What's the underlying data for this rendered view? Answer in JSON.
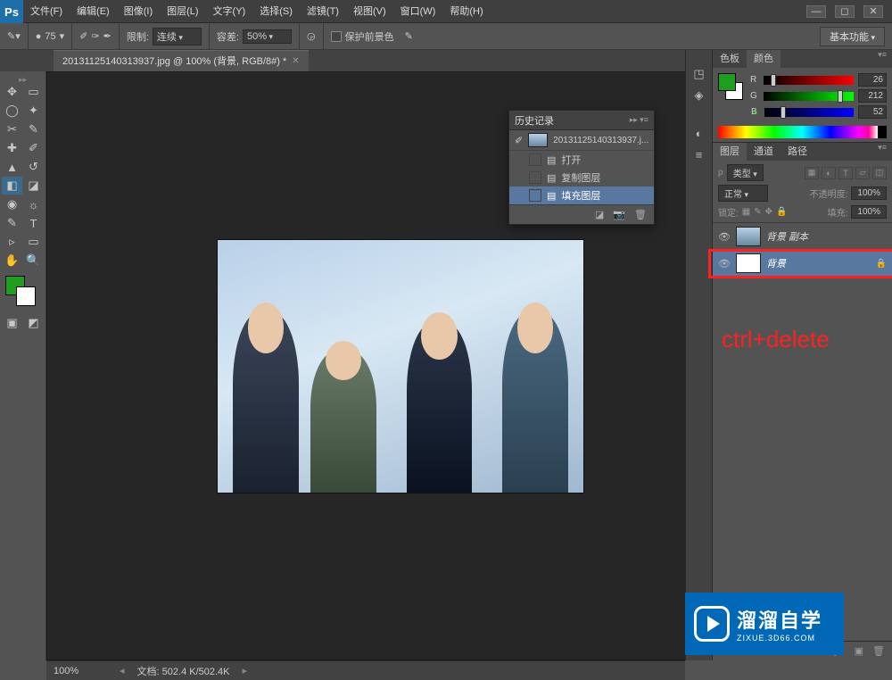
{
  "menubar": {
    "items": [
      "文件(F)",
      "编辑(E)",
      "图像(I)",
      "图层(L)",
      "文字(Y)",
      "选择(S)",
      "滤镜(T)",
      "视图(V)",
      "窗口(W)",
      "帮助(H)"
    ]
  },
  "optionsbar": {
    "brush_size": "75",
    "limits_label": "限制:",
    "limits_value": "连续",
    "tolerance_label": "容差:",
    "tolerance_value": "50%",
    "protect_fg": "保护前景色",
    "workspace": "基本功能"
  },
  "tab": {
    "title": "20131125140313937.jpg @ 100% (背景, RGB/8#) *"
  },
  "history": {
    "title": "历史记录",
    "doc_name": "20131125140313937.j...",
    "items": [
      "打开",
      "复制图层",
      "填充图层"
    ],
    "selected_index": 2
  },
  "color_panel": {
    "tab_swatch": "色板",
    "tab_color": "颜色",
    "r": "26",
    "g": "212",
    "b": "52"
  },
  "layers_panel": {
    "tab_layers": "图层",
    "tab_channels": "通道",
    "tab_paths": "路径",
    "kind_label": "类型",
    "blend_mode": "正常",
    "opacity_label": "不透明度:",
    "opacity_value": "100%",
    "lock_label": "锁定:",
    "fill_label": "填充:",
    "fill_value": "100%",
    "layers": [
      {
        "name": "背景 副本",
        "selected": false,
        "type": "img"
      },
      {
        "name": "背景",
        "selected": true,
        "type": "white",
        "locked": true
      }
    ]
  },
  "annotation": "ctrl+delete",
  "statusbar": {
    "zoom": "100%",
    "doc_info_label": "文档:",
    "doc_info": "502.4 K/502.4K"
  },
  "watermark": {
    "big": "溜溜自学",
    "small": "ZIXUE.3D66.COM"
  }
}
